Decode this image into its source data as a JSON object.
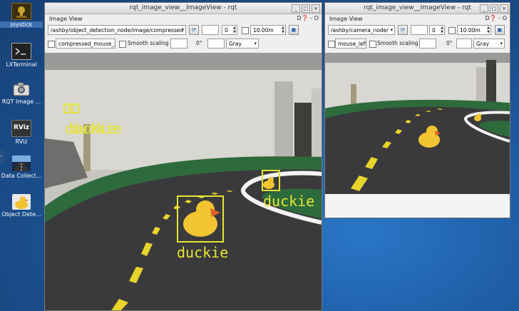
{
  "desktop": {
    "icons": [
      {
        "name": "joystick-icon",
        "label": "Joystick",
        "selected": true
      },
      {
        "name": "terminal-icon",
        "label": "LXTerminal",
        "selected": false
      },
      {
        "name": "camera-icon",
        "label": "RQT Image ...",
        "selected": false
      },
      {
        "name": "rviz-icon",
        "label": "RViz",
        "selected": false
      },
      {
        "name": "road-icon",
        "label": "Data Collect...",
        "selected": false
      },
      {
        "name": "duck-icon",
        "label": "Object Dete...",
        "selected": false
      }
    ],
    "rviz_icon_text": "RViz"
  },
  "window_left": {
    "title": "rqt_image_view__ImageView - rqt",
    "dock_title": "Image View",
    "dock_controls": "D❓ - O",
    "topic": "/ashby/object_detection_node/image/compressed",
    "value_field": "0",
    "distance_field": "10.00m",
    "mouse_topic": "compressed_mouse_left",
    "smooth_label": "Smooth scaling",
    "rotation": "0°",
    "color_mode": "Gray",
    "detections": [
      {
        "label": "duckie"
      },
      {
        "label": "duckie"
      },
      {
        "label": "duckie"
      }
    ],
    "overlap_label": "duckie"
  },
  "window_right": {
    "title": "rqt_image_view__ImageView - rqt",
    "dock_title": "Image View",
    "dock_controls": "D❓ - O",
    "topic": "/ashby/camera_node/",
    "value_field": "0",
    "distance_field": "10.00m",
    "mouse_topic": "mouse_left",
    "smooth_label": "Smooth scaling",
    "rotation": "0°",
    "color_mode": "Gray"
  },
  "colors": {
    "detection": "#e5e533",
    "lane": "#e8d42a",
    "road": "#3a3a3c",
    "mat": "#2f6e3a"
  }
}
